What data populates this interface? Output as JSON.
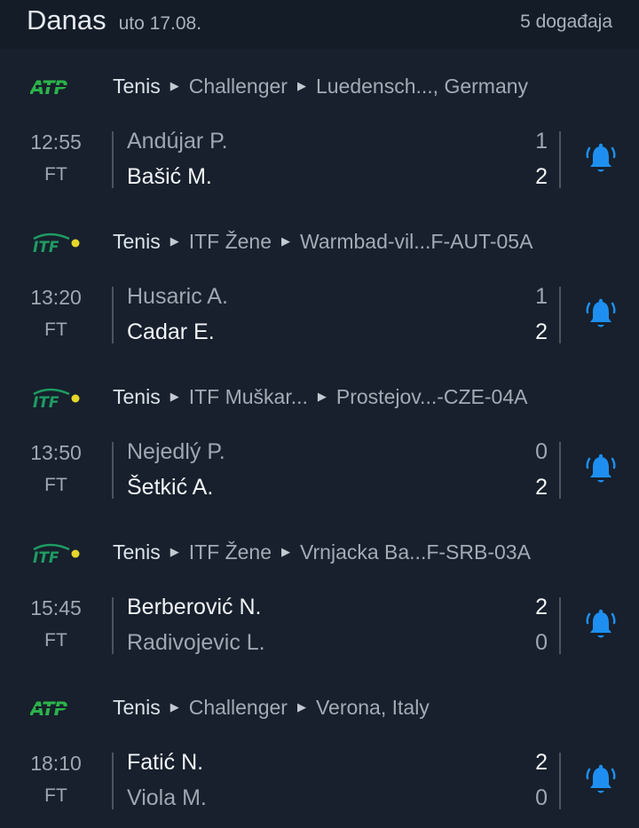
{
  "header": {
    "title": "Danas",
    "date": "uto 17.08.",
    "count": "5 događaja"
  },
  "colors": {
    "accent": "#1e8ff0",
    "atp_green": "#2cb34a",
    "itf_green": "#1f9c63",
    "ball_yellow": "#e5d62a"
  },
  "tournaments": [
    {
      "logo": "atp-logo",
      "sport": "Tenis",
      "category": "Challenger",
      "name": "Luedensch..., Germany",
      "match": {
        "time": "12:55",
        "status": "FT",
        "p1": "Andújar P.",
        "p2": "Bašić M.",
        "s1": "1",
        "s2": "2",
        "winner": 2
      }
    },
    {
      "logo": "itf-logo",
      "sport": "Tenis",
      "category": "ITF Žene",
      "name": "Warmbad-vil...F-AUT-05A",
      "match": {
        "time": "13:20",
        "status": "FT",
        "p1": "Husaric A.",
        "p2": "Cadar E.",
        "s1": "1",
        "s2": "2",
        "winner": 2
      }
    },
    {
      "logo": "itf-logo",
      "sport": "Tenis",
      "category": "ITF Muškar...",
      "name": "Prostejov...-CZE-04A",
      "match": {
        "time": "13:50",
        "status": "FT",
        "p1": "Nejedlý P.",
        "p2": "Šetkić A.",
        "s1": "0",
        "s2": "2",
        "winner": 2
      }
    },
    {
      "logo": "itf-logo",
      "sport": "Tenis",
      "category": "ITF Žene",
      "name": "Vrnjacka Ba...F-SRB-03A",
      "match": {
        "time": "15:45",
        "status": "FT",
        "p1": "Berberović N.",
        "p2": "Radivojevic L.",
        "s1": "2",
        "s2": "0",
        "winner": 1
      }
    },
    {
      "logo": "atp-logo",
      "sport": "Tenis",
      "category": "Challenger",
      "name": "Verona, Italy",
      "match": {
        "time": "18:10",
        "status": "FT",
        "p1": "Fatić N.",
        "p2": "Viola M.",
        "s1": "2",
        "s2": "0",
        "winner": 1
      }
    }
  ]
}
